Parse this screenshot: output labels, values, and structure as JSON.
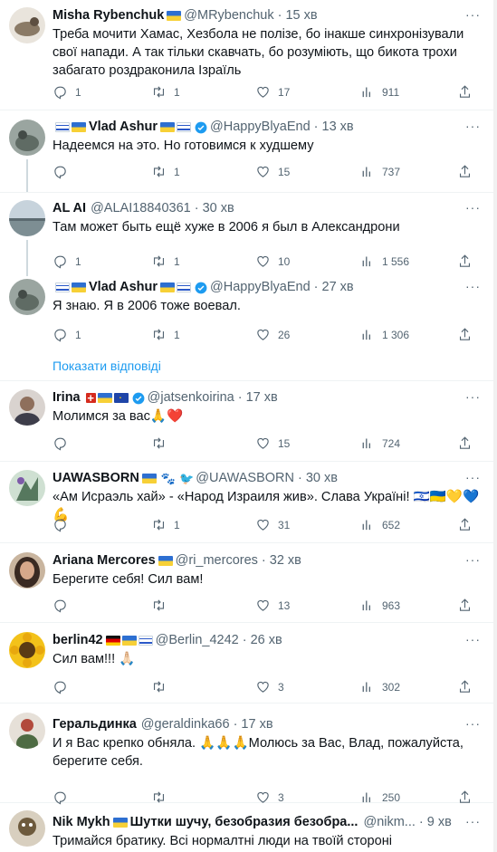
{
  "colors": {
    "accent": "#1d9bf0",
    "muted": "#536471",
    "text": "#0f1419",
    "heart": "#e0245e"
  },
  "show_replies": "Показати відповіді",
  "tweets": [
    {
      "name": "Misha Rybenchuk",
      "handle": "@MRybenchuk",
      "time": "15 хв",
      "text": "Треба мочити Хамас, Хезбола не полізе, бо інакше синхронізували свої напади. А так тільки скавчать, бо розуміють, що бикота трохи забагато роздраконила Ізраїль",
      "replies": "1",
      "retweets": "1",
      "likes": "17",
      "views": "911"
    },
    {
      "name": "Vlad Ashur",
      "handle": "@HappyBlyaEnd",
      "time": "13 хв",
      "text": "Надеемся на это. Но готовимся к худшему",
      "replies": "",
      "retweets": "1",
      "likes": "15",
      "views": "737"
    },
    {
      "name": "AL AI",
      "handle": "@ALAI18840361",
      "time": "30 хв",
      "text": "Там может быть ещё хуже в 2006 я был в Александрони",
      "replies": "1",
      "retweets": "1",
      "likes": "10",
      "views": "1 556"
    },
    {
      "name": "Vlad Ashur",
      "handle": "@HappyBlyaEnd",
      "time": "27 хв",
      "text": "Я знаю. Я в 2006 тоже воевал.",
      "replies": "1",
      "retweets": "1",
      "likes": "26",
      "views": "1 306"
    },
    {
      "name": "Irina",
      "handle": "@jatsenkoirina",
      "time": "17 хв",
      "text": "Молимся за вас🙏❤️",
      "replies": "",
      "retweets": "",
      "likes": "15",
      "views": "724"
    },
    {
      "name": "UAWASBORN",
      "handle": "@UAWASBORN",
      "time": "30 хв",
      "text": "«Ам Исраэль хай» - «Народ Израиля жив». Слава Україні! 🇮🇱🇺🇦💛💙💪",
      "replies": "",
      "retweets": "1",
      "likes": "31",
      "views": "652"
    },
    {
      "name": "Ariana Mercores",
      "handle": "@ri_mercores",
      "time": "32 хв",
      "text": "Берегите себя! Сил вам!",
      "replies": "",
      "retweets": "",
      "likes": "13",
      "views": "963"
    },
    {
      "name": "berlin42",
      "handle": "@Berlin_4242",
      "time": "26 хв",
      "text": "Сил вам!!! 🙏🏻",
      "replies": "",
      "retweets": "",
      "likes": "3",
      "views": "302"
    },
    {
      "name": "Геральдинка",
      "handle": "@geraldinka66",
      "time": "17 хв",
      "text": "И я Вас крепко обняла. 🙏🙏🙏Молюсь за Вас, Влад, пожалуйста, берегите себя.",
      "replies": "",
      "retweets": "",
      "likes": "3",
      "views": "250"
    },
    {
      "name": "Nik Mykh",
      "name_extra": "Шутки шучу, безобразия безобра...",
      "handle": "@nikm...",
      "time": "9 хв",
      "text": "Тримайся братику. Всі нормалтні люди на твоїй стороні",
      "replies": "",
      "retweets": "",
      "likes": "",
      "views": ""
    }
  ]
}
